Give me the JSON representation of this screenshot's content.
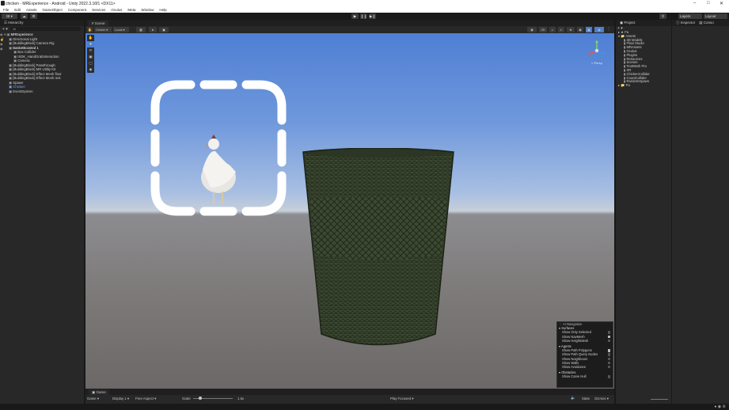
{
  "window": {
    "title": "chicken - MRExperience - Android - Unity 2022.3.16f1 <DX11>"
  },
  "menu": [
    "File",
    "Edit",
    "Assets",
    "GameObject",
    "Component",
    "Services",
    "Oculus",
    "Meta",
    "Window",
    "Help"
  ],
  "toolbar": {
    "account": "IB",
    "layers_label": "Layers",
    "layout_label": "Layout"
  },
  "hierarchy": {
    "tab": "Hierarchy",
    "search_placeholder": "All",
    "items": [
      {
        "label": "MRExperience",
        "indent": 0,
        "style": "sel"
      },
      {
        "label": "Directional Light",
        "indent": 1,
        "style": ""
      },
      {
        "label": "[BuildingBlock] Camera Rig",
        "indent": 1,
        "style": ""
      },
      {
        "label": "BasketBoosted 1",
        "indent": 1,
        "style": "sel"
      },
      {
        "label": "Box Collider",
        "indent": 2,
        "style": ""
      },
      {
        "label": "ISDK_HandGrabInteraction",
        "indent": 2,
        "style": ""
      },
      {
        "label": "Camera",
        "indent": 2,
        "style": ""
      },
      {
        "label": "[BuildingBlock] Passthrough",
        "indent": 1,
        "style": ""
      },
      {
        "label": "[BuildingBlock] MR Utility Kit",
        "indent": 1,
        "style": ""
      },
      {
        "label": "[BuildingBlock] Effect Mesh floor",
        "indent": 1,
        "style": ""
      },
      {
        "label": "[BuildingBlock] Effect Mesh rest",
        "indent": 1,
        "style": ""
      },
      {
        "label": "Spawn",
        "indent": 1,
        "style": ""
      },
      {
        "label": "Chicken",
        "indent": 1,
        "style": "blue"
      },
      {
        "label": "EventSystem",
        "indent": 1,
        "style": ""
      }
    ]
  },
  "scene": {
    "tab": "Scene",
    "center_label": "Center",
    "local_label": "Local",
    "persp_label": "< Persp"
  },
  "navigation": {
    "title": "AI Navigation",
    "surfaces_header": "Surfaces",
    "surfaces": [
      {
        "label": "Show Only Selected",
        "checked": false
      },
      {
        "label": "Show NavMesh",
        "checked": true
      },
      {
        "label": "Show HeightMesh",
        "checked": false
      }
    ],
    "agents_header": "Agents",
    "agents": [
      {
        "label": "Show Path Polygons",
        "checked": true
      },
      {
        "label": "Show Path Query Nodes",
        "checked": false
      },
      {
        "label": "Show Neighbours",
        "checked": false
      },
      {
        "label": "Show Walls",
        "checked": false
      },
      {
        "label": "Show Avoidance",
        "checked": false
      }
    ],
    "obstacles_header": "Obstacles",
    "obstacles": [
      {
        "label": "Show Carve Hull",
        "checked": false
      }
    ]
  },
  "game": {
    "tab": "Game",
    "mode": "Game",
    "display": "Display 1",
    "aspect": "Free Aspect",
    "scale_label": "Scale",
    "scale_value": "1.5x",
    "play_focused": "Play Focused",
    "stats": "Stats",
    "gizmos": "Gizmos"
  },
  "project": {
    "tab": "Project",
    "favorites": "Fa",
    "assets_header": "Assets",
    "folders": [
      "3D Models",
      "Float Studio",
      "MRAssets",
      "Oculus",
      "Plugins",
      "Resources",
      "Scenes",
      "TextMesh Pro",
      "XR",
      "ChickenCollider",
      "CountCollider",
      "RandomSpawn"
    ],
    "packages": "Pa"
  },
  "inspector": {
    "tab": "Inspector",
    "console_tab": "Conso"
  },
  "colors": {
    "accent": "#4a7fd1",
    "basket": "#3b4a2e",
    "panel": "#282828"
  }
}
